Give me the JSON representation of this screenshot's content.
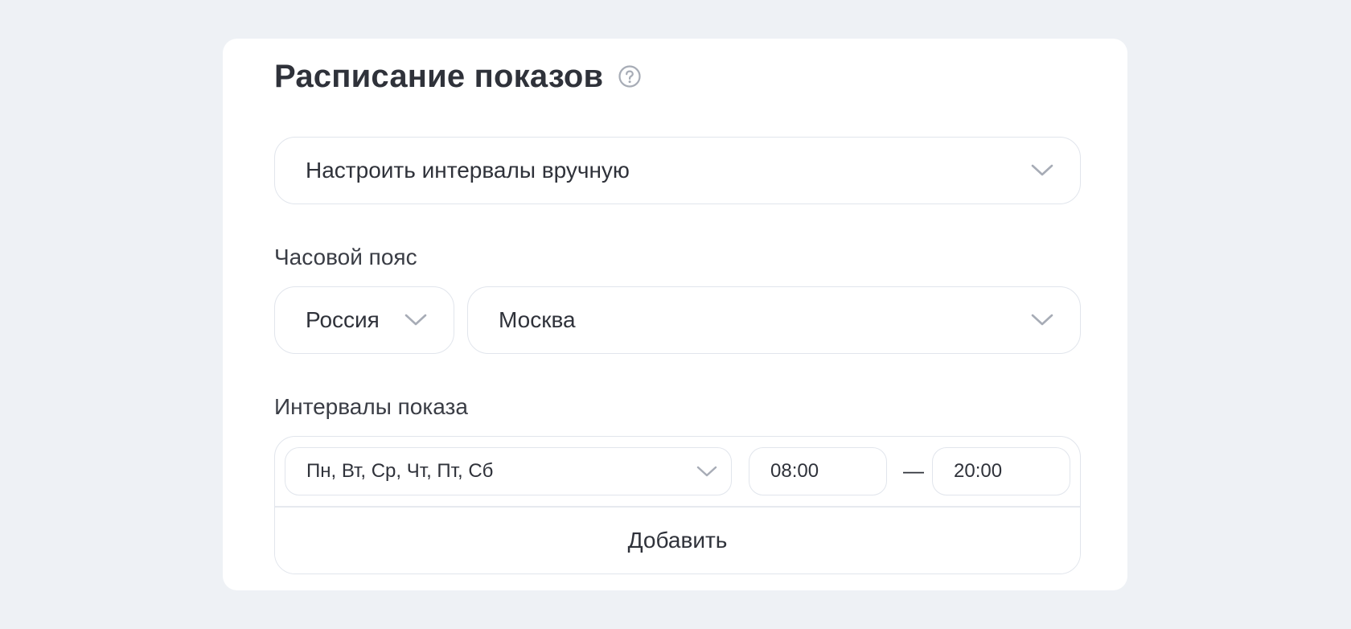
{
  "schedule": {
    "title": "Расписание показов",
    "help_icon": "question-circle-icon",
    "mode_select": {
      "value": "Настроить интервалы вручную",
      "icon": "chevron-down-icon"
    },
    "timezone": {
      "label": "Часовой пояс",
      "country": "Россия",
      "city": "Москва"
    },
    "intervals": {
      "label": "Интервалы показа",
      "rows": [
        {
          "days": "Пн, Вт, Ср, Чт, Пт, Сб",
          "from": "08:00",
          "separator": "—",
          "to": "20:00"
        }
      ],
      "add_label": "Добавить"
    }
  },
  "colors": {
    "page_background": "#eef1f5",
    "card_background": "#ffffff",
    "border": "#e1e5ec",
    "text": "#2f323a",
    "icon": "#a7acb6"
  }
}
